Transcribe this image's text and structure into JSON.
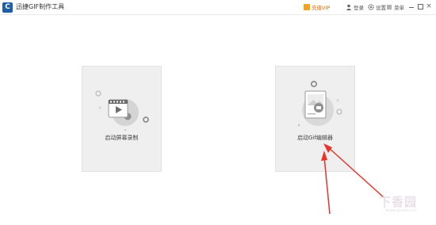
{
  "app": {
    "title": "迅捷GIF制作工具",
    "logo_letter": "C"
  },
  "toolbar": {
    "vip_label": "充值VIP",
    "login_label": "登录",
    "settings_label": "设置",
    "minimize_label": "菜单",
    "close_glyph": "×"
  },
  "cards": {
    "record": {
      "label": "启动屏幕录制",
      "icon": "video-camera-icon"
    },
    "edit": {
      "label": "启动Gif编辑器",
      "icon": "gif-editor-icon"
    }
  },
  "watermark": {
    "text": "下香园",
    "url": "www.pcwin.cn"
  },
  "colors": {
    "accent": "#1f5fa8",
    "vip": "#e06a00",
    "arrow": "#e8342a",
    "card_bg": "#efefef"
  }
}
